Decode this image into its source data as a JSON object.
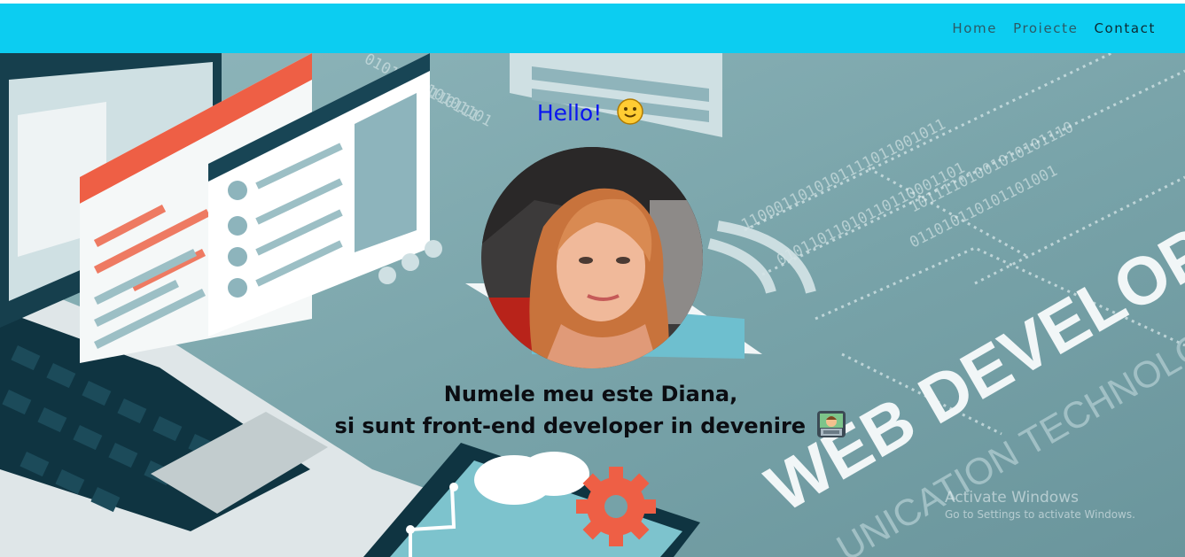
{
  "nav": {
    "items": [
      "Home",
      "Proiecte",
      "Contact"
    ]
  },
  "hero": {
    "greeting": "Hello!",
    "greeting_emoji": "slightly-smiling-face-icon",
    "intro_line1": "Numele meu este Diana,",
    "intro_line2": "si sunt front-end developer in devenire",
    "intro_emoji": "technologist-icon",
    "background_text": [
      "WEB DEVELOPM",
      "UNICATION TECHNOLO"
    ]
  },
  "watermark": {
    "title": "Activate Windows",
    "subtitle": "Go to Settings to activate Windows."
  },
  "colors": {
    "navbar": "#0ccdf1",
    "greeting": "#0a15f0",
    "hero_bg": "#76a2a8"
  }
}
